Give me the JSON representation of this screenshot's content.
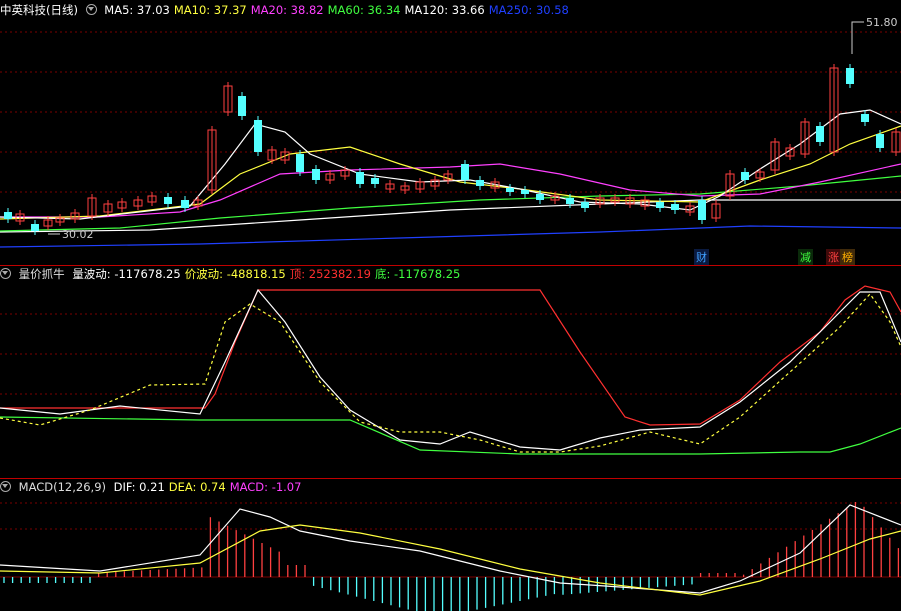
{
  "stock": {
    "name": "中英科技",
    "period": "(日线)"
  },
  "price_header": {
    "items": [
      {
        "label": "MA5: 37.03",
        "color": "#ffffff"
      },
      {
        "label": "MA10: 37.37",
        "color": "#ffff40"
      },
      {
        "label": "MA20: 38.82",
        "color": "#ff40ff"
      },
      {
        "label": "MA60: 36.34",
        "color": "#40ff40"
      },
      {
        "label": "MA120: 33.66",
        "color": "#ffffff"
      },
      {
        "label": "MA250: 30.58",
        "color": "#2040ff"
      }
    ]
  },
  "price_labels": {
    "high": "51.80",
    "low": "30.02"
  },
  "event_tags": [
    {
      "text": "财",
      "color": "#40a0ff"
    },
    {
      "text": "减",
      "color": "#40ff40"
    },
    {
      "text": "涨",
      "color": "#ff4040"
    },
    {
      "text": "榜",
      "color": "#ffb000"
    }
  ],
  "indicator1_header": {
    "name": "量价抓牛",
    "items": [
      {
        "label": "量波动: -117678.25",
        "color": "#ffffff"
      },
      {
        "label": "价波动: -48818.15",
        "color": "#ffff40"
      },
      {
        "label": "顶: 252382.19",
        "color": "#ff3030"
      },
      {
        "label": "底: -117678.25",
        "color": "#40ff40"
      }
    ]
  },
  "macd_header": {
    "name": "MACD(12,26,9)",
    "items": [
      {
        "label": "DIF: 0.21",
        "color": "#ffffff"
      },
      {
        "label": "DEA: 0.74",
        "color": "#ffff40"
      },
      {
        "label": "MACD: -1.07",
        "color": "#ff40ff"
      }
    ]
  }
}
